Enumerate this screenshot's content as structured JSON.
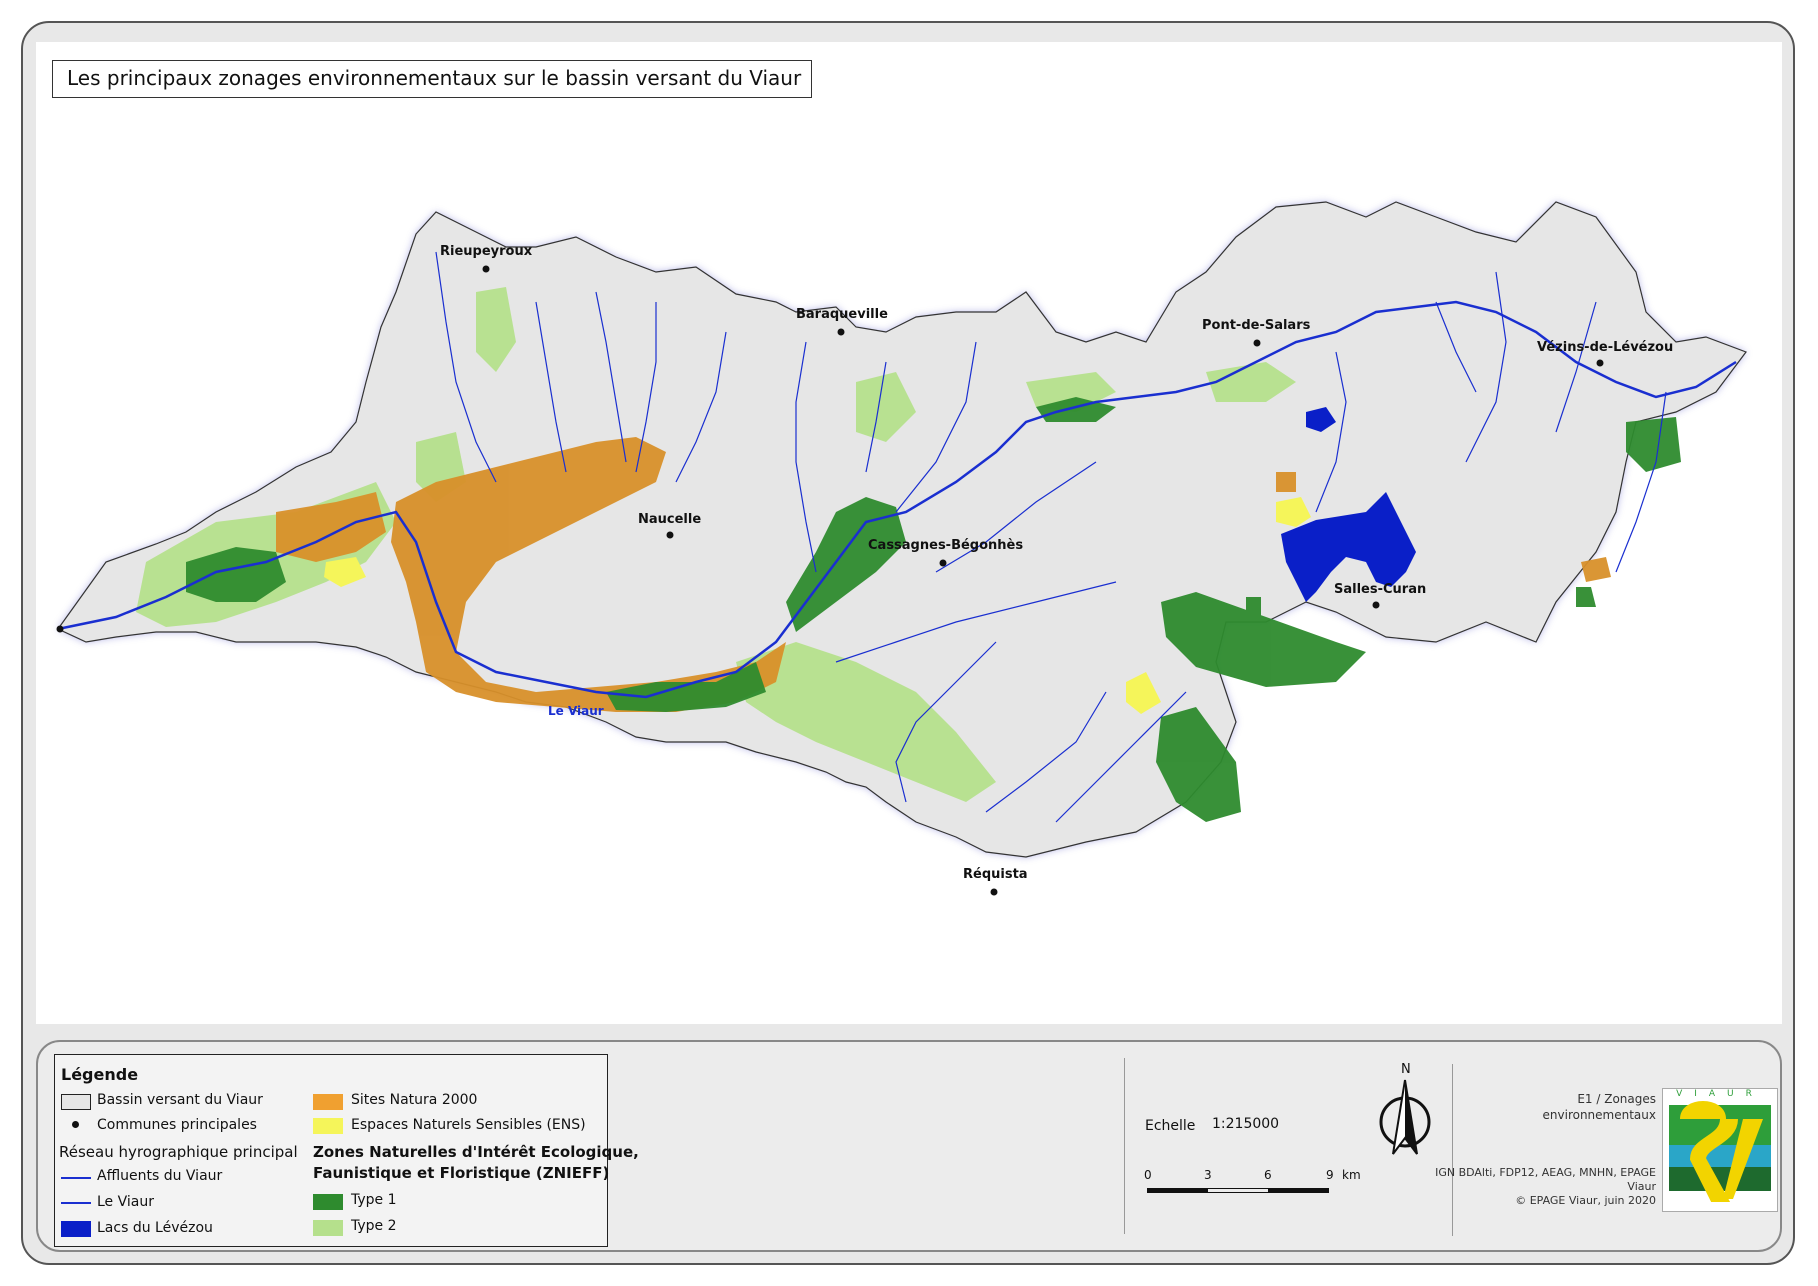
{
  "title": "Les principaux zonages environnementaux sur le bassin versant du Viaur",
  "towns": [
    "Rieupeyroux",
    "Baraqueville",
    "Naucelle",
    "Cassagnes-Bégonhès",
    "Pont-de-Salars",
    "Vézins-de-Lévézou",
    "Salles-Curan",
    "Réquista"
  ],
  "river_label": "Le Viaur",
  "legend": {
    "title": "Légende",
    "items": {
      "bassin": "Bassin versant du Viaur",
      "communes": "Communes principales",
      "reseau_title": "Réseau hyrographique principal",
      "affluents": "Affluents du Viaur",
      "viaur": "Le Viaur",
      "lacs": "Lacs du Lévézou",
      "natura": "Sites Natura 2000",
      "ens": "Espaces Naturels Sensibles (ENS)",
      "znieff_title_1": "Zones Naturelles d'Intérêt Ecologique,",
      "znieff_title_2": "Faunistique et Floristique (ZNIEFF)",
      "type1": "Type 1",
      "type2": "Type 2"
    }
  },
  "scale": {
    "label": "Echelle",
    "value": "1:215000",
    "ticks": [
      "0",
      "3",
      "6",
      "9"
    ],
    "unit": "km"
  },
  "north": "N",
  "meta": {
    "line1": "E1 / Zonages",
    "line2": "environnementaux",
    "sources_1": "IGN BDAlti, FDP12, AEAG, MNHN, EPAGE",
    "sources_2": "Viaur",
    "copyright": "© EPAGE Viaur, juin 2020"
  },
  "logo_text": "VIAUR",
  "colors": {
    "natura": "#f0a030",
    "ens": "#f5f55a",
    "type1": "#2e8b2e",
    "type2": "#b5e08c",
    "lacs": "#0a1fc8",
    "river": "#1a2fd0",
    "bassin_fill": "#e6e6e6"
  }
}
